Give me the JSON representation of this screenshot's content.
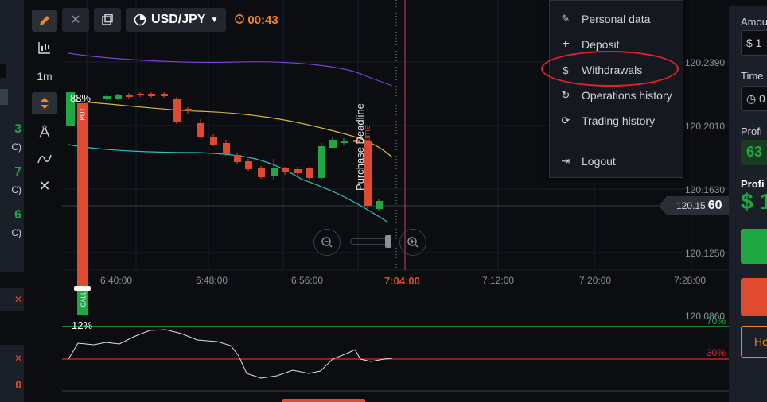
{
  "toolbar": {
    "pair": "USD/JPY",
    "timer": "00:43",
    "timeframe": "1m"
  },
  "menu": {
    "items": [
      {
        "label": "Personal data",
        "icon": "edit-icon"
      },
      {
        "label": "Deposit",
        "icon": "plus-icon"
      },
      {
        "label": "Withdrawals",
        "icon": "dollar-icon"
      },
      {
        "label": "Operations history",
        "icon": "refresh-icon"
      },
      {
        "label": "Trading history",
        "icon": "sync-icon"
      },
      {
        "label": "Logout",
        "icon": "logout-icon"
      }
    ]
  },
  "right_panel": {
    "amount_label": "Amou",
    "amount_value": "$ 1",
    "time_label": "Time",
    "time_value": "0",
    "profit_label": "Profi",
    "profit_value": "63",
    "profit_label2": "Profi",
    "profit_amount": "$ 1",
    "outline_btn": "Ho"
  },
  "left_strip": {
    "val1": "3",
    "sub1": "C)",
    "val2": "7",
    "sub2": "C)",
    "val3": "6",
    "sub3": "C)",
    "val4": "0"
  },
  "chart": {
    "put_percent": "88%",
    "call_percent": "12%",
    "put_label": "PUT",
    "call_label": "CALL",
    "purchase_deadline": "Purchase Deadline",
    "expiration_time": "Expiration time",
    "price_small": "120.15",
    "price_big": "60",
    "y_labels": [
      "120.2390",
      "120.2010",
      "120.1630",
      "120.1250",
      "120.0860"
    ],
    "x_labels": [
      "6:40:00",
      "6:48:00",
      "6:56:00",
      "7:04:00",
      "7:12:00",
      "7:20:00",
      "7:28:00"
    ],
    "osc_upper": "70%",
    "osc_lower": "30%"
  },
  "colors": {
    "up": "#1fa744",
    "down": "#e04a2f",
    "accent": "#f5861f",
    "purple": "#7b3fd6",
    "yellow": "#d9b93a",
    "cyan": "#2bc0c0",
    "highlight": "#e0212f"
  }
}
